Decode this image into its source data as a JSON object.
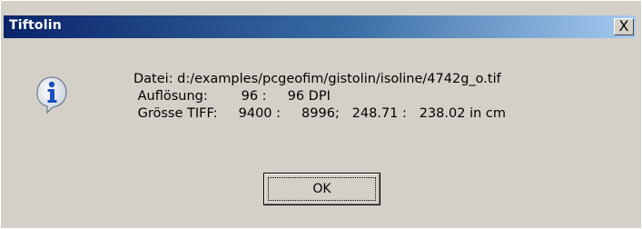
{
  "dialog": {
    "title": "Tiftolin",
    "close_glyph": "X",
    "icon": "info-icon",
    "lines": [
      "Datei: d:/examples/pcgeofim/gistolin/isoline/4742g_o.tif",
      " Auflösung:        96 :     96 DPI",
      " Grösse TIFF:     9400 :     8996;   248.71 :   238.02 in cm"
    ],
    "ok_label": "OK"
  },
  "colors": {
    "title_start": "#0a246a",
    "title_end": "#a6caf0",
    "face": "#d4d0c8",
    "icon_blue": "#1f4fbf"
  }
}
